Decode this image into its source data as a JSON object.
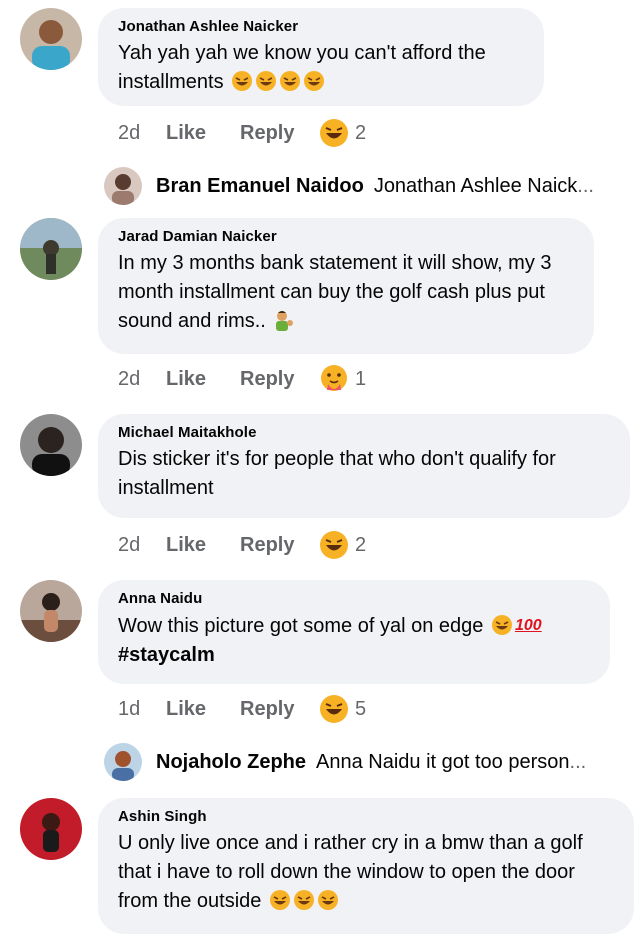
{
  "comments": [
    {
      "author": "Jonathan Ashlee Naicker",
      "text_line1": "Yah yah yah we know you can't afford the",
      "text_line2": "installments",
      "time": "2d",
      "like": "Like",
      "reply": "Reply",
      "reaction_icon": "laughing-emoji",
      "reaction_count": "2"
    },
    {
      "author": "Jarad Damian Naicker",
      "text_line1": "In my 3 months bank statement it will show, my 3",
      "text_line2": "month installment can buy the golf cash plus put",
      "text_line3": "sound and rims..",
      "time": "2d",
      "like": "Like",
      "reply": "Reply",
      "reaction_icon": "care-emoji",
      "reaction_count": "1"
    },
    {
      "author": "Michael Maitakhole",
      "text_line1": "Dis sticker it's for people that who don't qualify for",
      "text_line2": "installment",
      "time": "2d",
      "like": "Like",
      "reply": "Reply",
      "reaction_icon": "laughing-emoji",
      "reaction_count": "2"
    },
    {
      "author": "Anna Naidu",
      "text_line1": "Wow this picture got some of yal on edge",
      "text_line2": "#staycalm",
      "hundred": "100",
      "time": "1d",
      "like": "Like",
      "reply": "Reply",
      "reaction_icon": "laughing-emoji",
      "reaction_count": "5"
    },
    {
      "author": "Ashin Singh",
      "text_line1": "U only live once and i rather cry in a bmw than a golf",
      "text_line2": "that i have to roll down the window to open the door",
      "text_line3": "from the outside"
    }
  ],
  "replies": [
    {
      "author": "Bran Emanuel Naidoo",
      "text": "Jonathan Ashlee Naick",
      "ellipsis": "..."
    },
    {
      "author": "Nojaholo Zephe",
      "text": "Anna Naidu it got too person",
      "ellipsis": "..."
    }
  ],
  "colors": {
    "bubble": "#f0f2f5",
    "meta": "#65676b",
    "emoji": "#f7b125"
  }
}
